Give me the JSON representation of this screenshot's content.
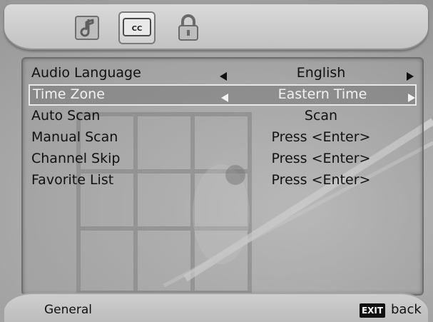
{
  "top_tabs": [
    {
      "icon": "audio-note-icon",
      "active": false
    },
    {
      "icon": "cc-icon",
      "label": "CC",
      "active": true
    },
    {
      "icon": "lock-icon",
      "active": false
    }
  ],
  "menu": {
    "items": [
      {
        "label": "Audio Language",
        "value": "English",
        "arrows": true,
        "selected": false
      },
      {
        "label": "Time Zone",
        "value": "Eastern Time",
        "arrows": true,
        "selected": true
      },
      {
        "label": "Auto Scan",
        "value": "Scan",
        "arrows": false,
        "selected": false
      },
      {
        "label": "Manual Scan",
        "value": "Press <Enter>",
        "arrows": false,
        "selected": false
      },
      {
        "label": "Channel Skip",
        "value": "Press <Enter>",
        "arrows": false,
        "selected": false
      },
      {
        "label": "Favorite List",
        "value": "Press <Enter>",
        "arrows": false,
        "selected": false
      }
    ]
  },
  "footer": {
    "section": "General",
    "exit_key": "EXIT",
    "back_label": "back"
  }
}
